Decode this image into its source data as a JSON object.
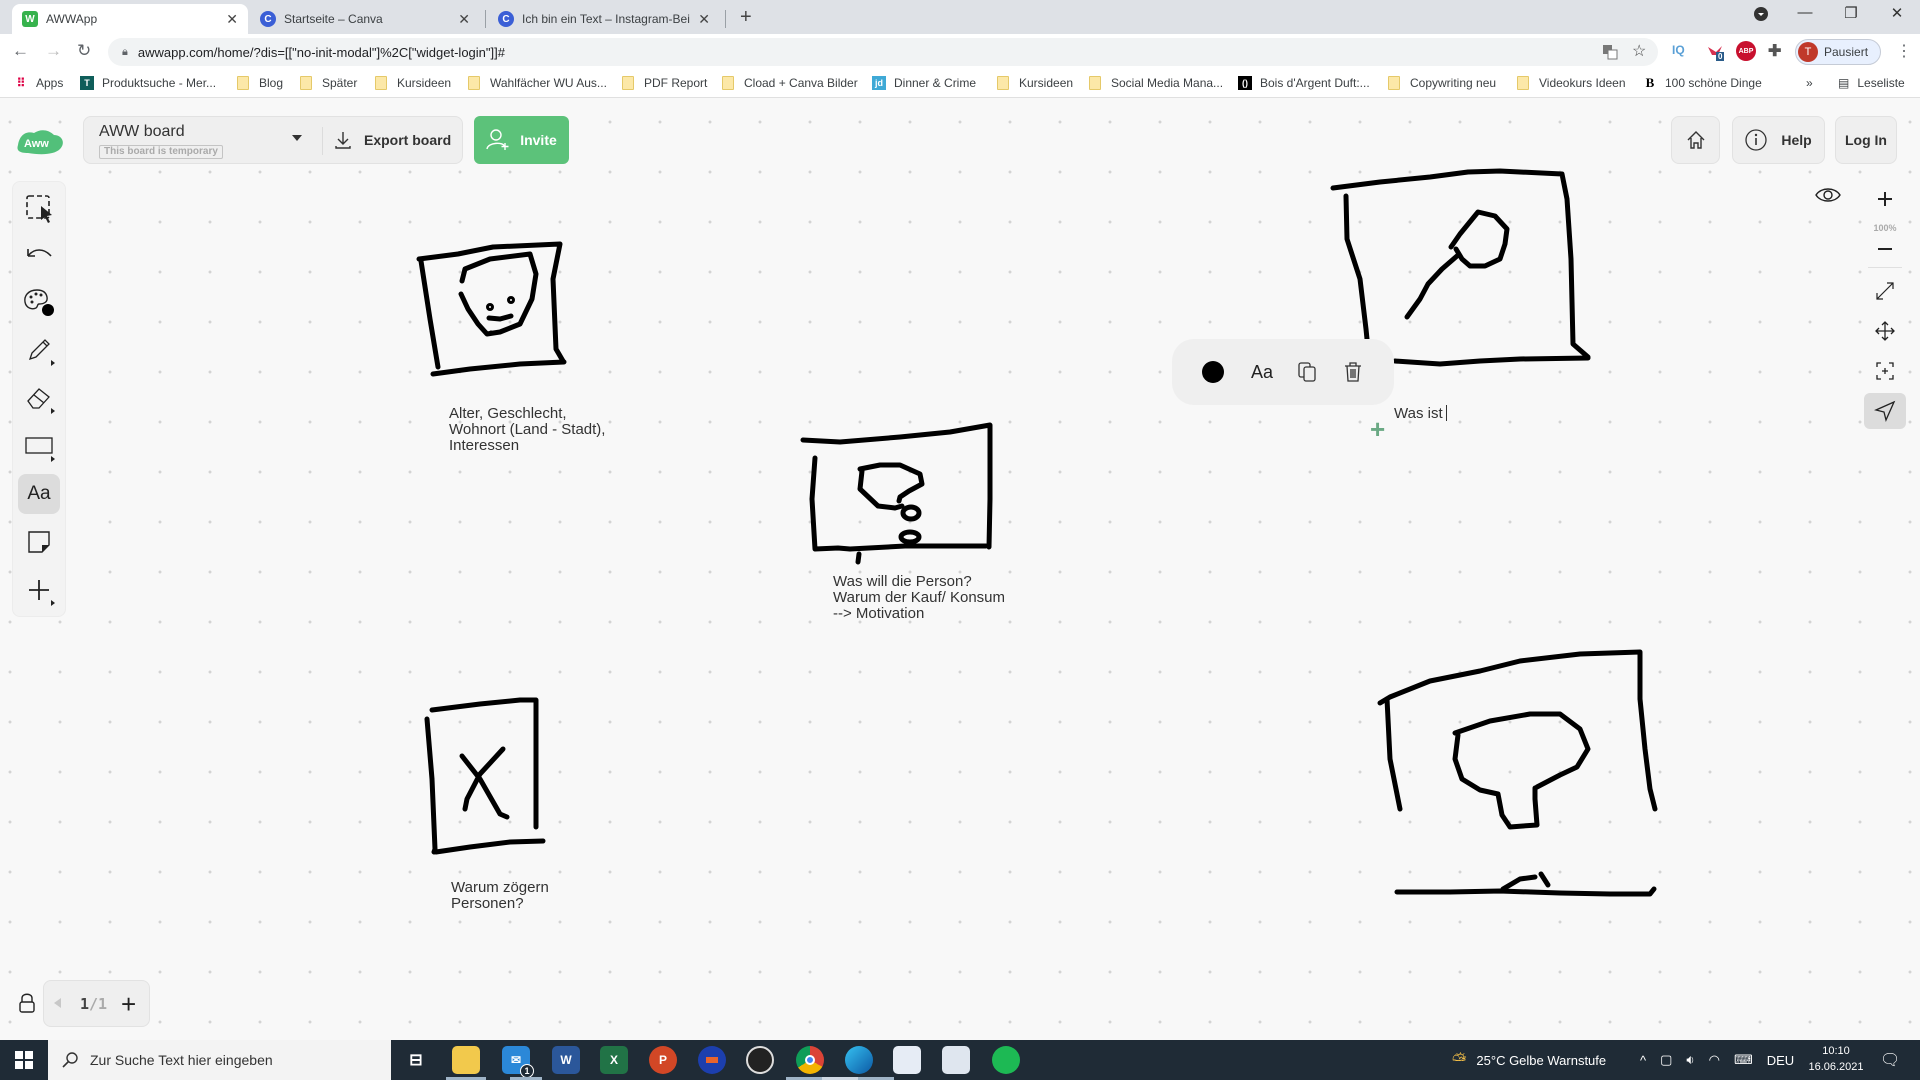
{
  "browser": {
    "tabs": [
      {
        "title": "AWWApp",
        "favicon": "W",
        "active": true
      },
      {
        "title": "Startseite – Canva",
        "favicon": "C",
        "active": false
      },
      {
        "title": "Ich bin ein Text – Instagram-Beitr",
        "favicon": "C",
        "active": false
      }
    ],
    "new_tab_label": "+",
    "url": "awwapp.com/home/?dis=[[\"no-init-modal\"]%2C[\"widget-login\"]]#",
    "profile_initial": "T",
    "profile_label": "Pausiert",
    "extension_badge": "0",
    "ext_iq": "IQ",
    "ext_abp": "ABP",
    "bookmarks": [
      {
        "label": "Apps",
        "icon": "apps-grid"
      },
      {
        "label": "Produktsuche - Mer...",
        "icon": "shirt"
      },
      {
        "label": "Blog",
        "icon": "folder"
      },
      {
        "label": "Später",
        "icon": "folder"
      },
      {
        "label": "Kursideen",
        "icon": "folder"
      },
      {
        "label": "Wahlfächer WU Aus...",
        "icon": "folder"
      },
      {
        "label": "PDF Report",
        "icon": "folder"
      },
      {
        "label": "Cload + Canva Bilder",
        "icon": "folder"
      },
      {
        "label": "Dinner & Crime",
        "icon": "jd"
      },
      {
        "label": "Kursideen",
        "icon": "folder"
      },
      {
        "label": "Social Media Mana...",
        "icon": "folder"
      },
      {
        "label": "Bois d'Argent Duft:...",
        "icon": "dior"
      },
      {
        "label": "Copywriting neu",
        "icon": "folder"
      },
      {
        "label": "Videokurs Ideen",
        "icon": "folder"
      },
      {
        "label": "100 schöne Dinge",
        "icon": "B"
      }
    ],
    "bookmarks_overflow": "»",
    "reading_list": "Leseliste"
  },
  "app": {
    "board_name": "AWW board",
    "board_status": "This board is temporary",
    "export_label": "Export board",
    "invite_label": "Invite",
    "help_label": "Help",
    "login_label": "Log In",
    "zoom_level": "100%",
    "page_current": "1",
    "page_total": "/1",
    "accent_color": "#5cc27a",
    "tools": [
      {
        "name": "select",
        "icon": "select-icon"
      },
      {
        "name": "undo",
        "icon": "undo-icon"
      },
      {
        "name": "color",
        "icon": "palette-icon"
      },
      {
        "name": "pen",
        "icon": "pencil-icon"
      },
      {
        "name": "eraser",
        "icon": "eraser-icon"
      },
      {
        "name": "shape",
        "icon": "rectangle-icon"
      },
      {
        "name": "text",
        "icon": "text-icon",
        "label": "Aa",
        "active": true
      },
      {
        "name": "sticky-note",
        "icon": "sticky-note-icon"
      },
      {
        "name": "add",
        "icon": "plus-icon"
      }
    ],
    "context_menu": {
      "color": "#000000",
      "font_label": "Aa"
    }
  },
  "canvas": {
    "notes": [
      {
        "id": "demographics",
        "text": "Alter, Geschlecht,\nWohnort (Land - Stadt),\nInteressen"
      },
      {
        "id": "motivation",
        "text": "Was will die Person?\nWarum der Kauf/ Konsum\n--> Motivation"
      },
      {
        "id": "hesitation",
        "text": "Warum zögern\nPersonen?"
      }
    ],
    "editing_text": "Was ist"
  },
  "taskbar": {
    "search_placeholder": "Zur Suche Text hier eingeben",
    "mail_badge": "1",
    "weather": "25°C  Gelbe Warnstufe",
    "language": "DEU",
    "time": "10:10",
    "date": "16.06.2021"
  }
}
